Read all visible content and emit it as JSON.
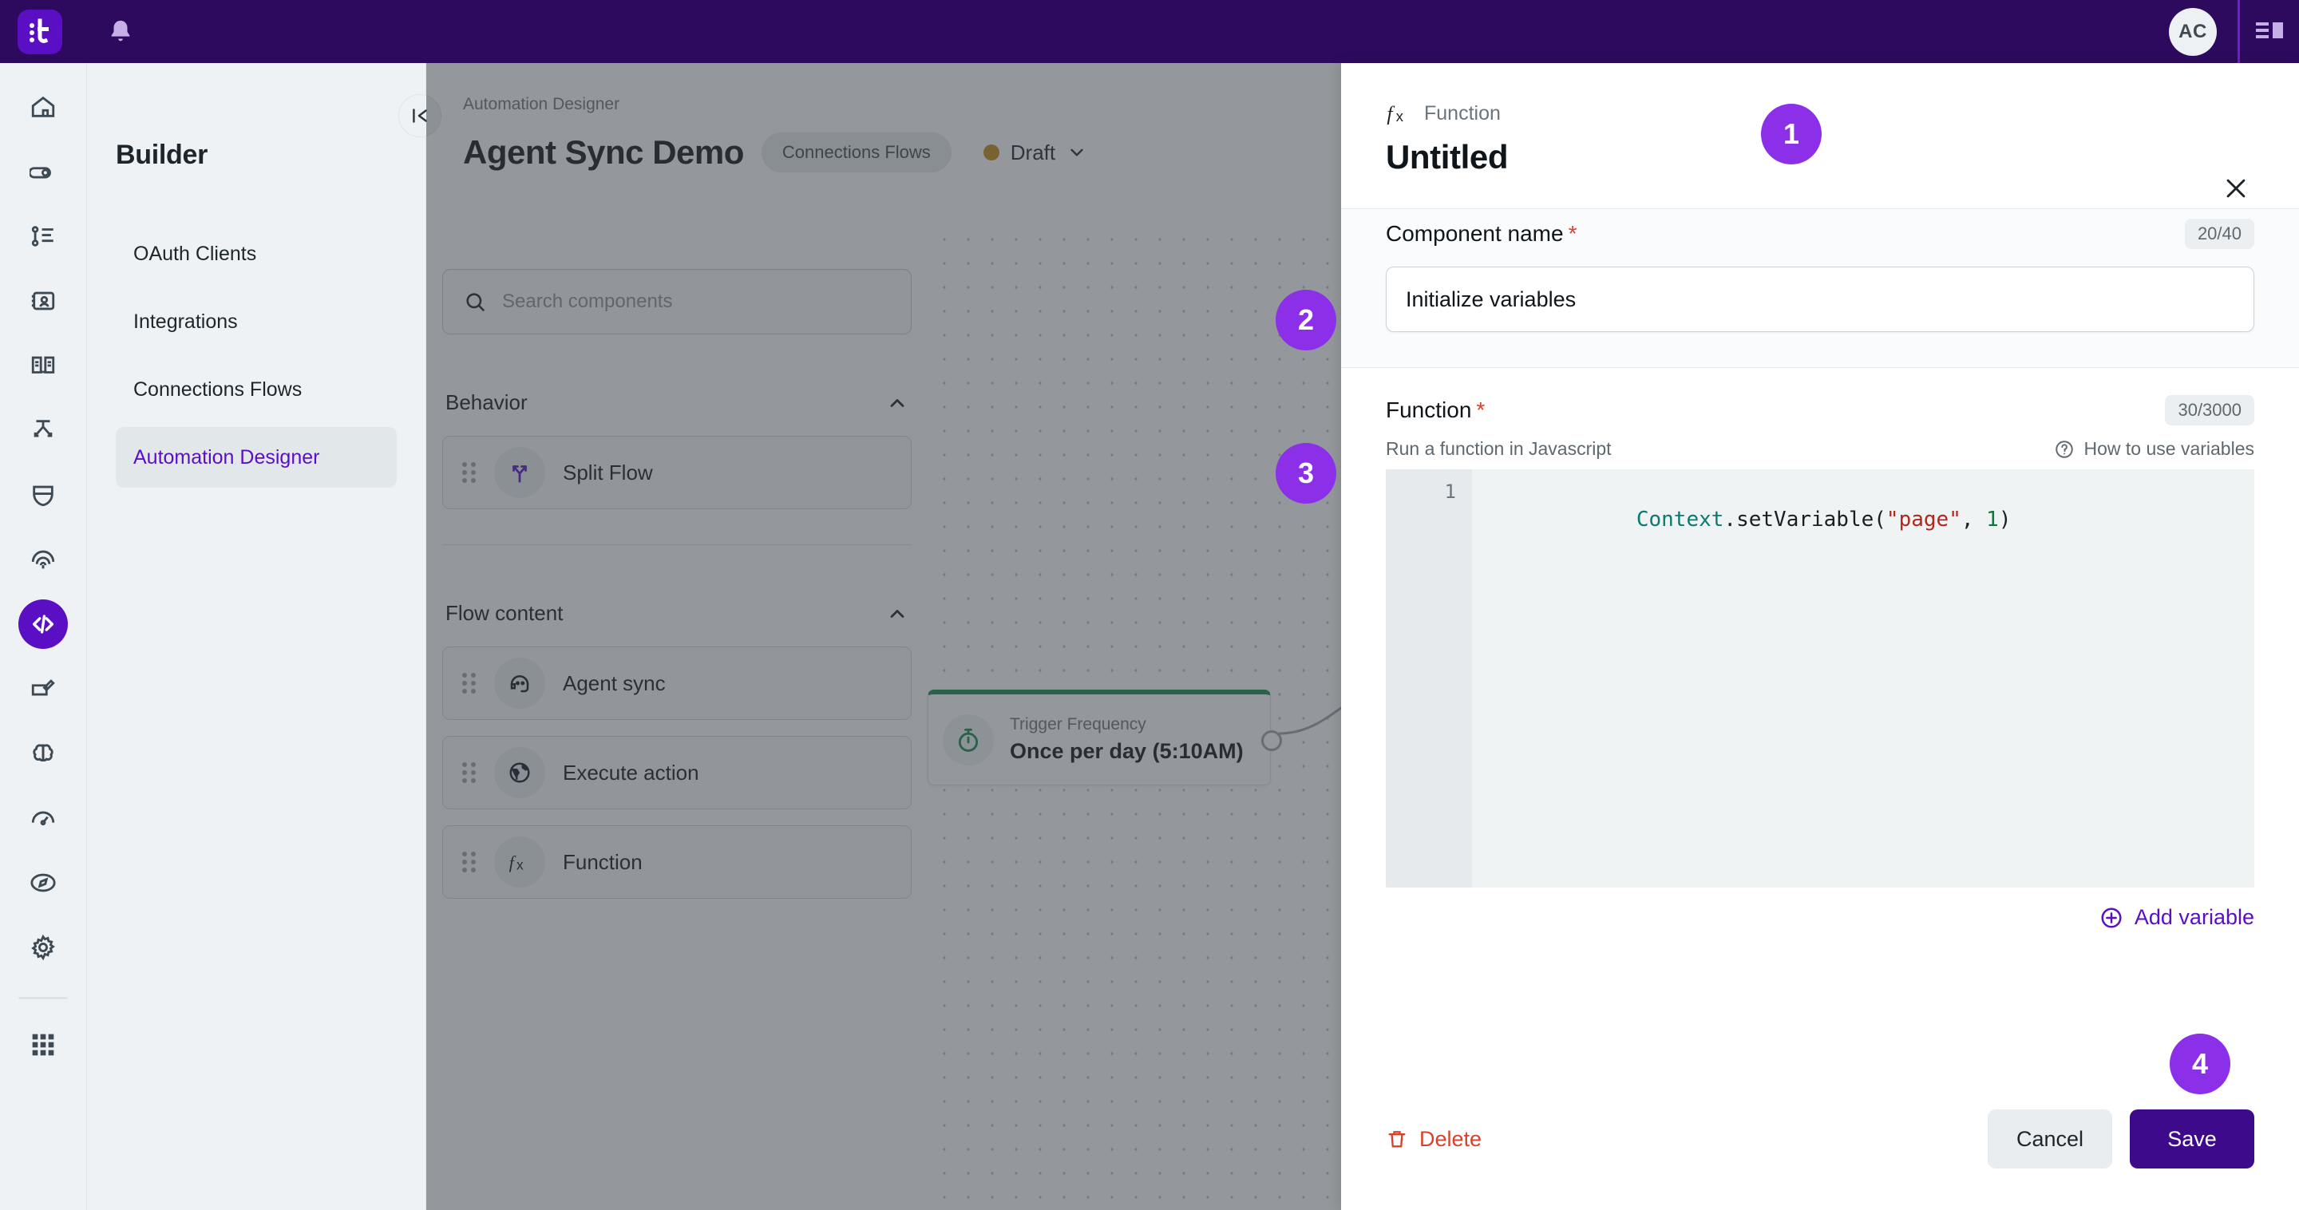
{
  "topbar": {
    "logo_name": "tray-logo",
    "bell_name": "notifications-bell-icon",
    "avatar_initials": "AC",
    "panel_toggle_name": "panel-layout-toggle"
  },
  "rail": {
    "items": [
      {
        "icon": "home-icon",
        "name": "rail-item-home",
        "active": false
      },
      {
        "icon": "link-icon",
        "name": "rail-item-connections",
        "active": false
      },
      {
        "icon": "list-tree-icon",
        "name": "rail-item-hierarchy",
        "active": false
      },
      {
        "icon": "contact-card-icon",
        "name": "rail-item-contacts",
        "active": false
      },
      {
        "icon": "book-icon",
        "name": "rail-item-knowledge",
        "active": false
      },
      {
        "icon": "routing-icon",
        "name": "rail-item-routing",
        "active": false
      },
      {
        "icon": "shield-icon",
        "name": "rail-item-security",
        "active": false
      },
      {
        "icon": "fingerprint-icon",
        "name": "rail-item-identity",
        "active": false
      },
      {
        "icon": "code-icon",
        "name": "rail-item-builder",
        "active": true
      },
      {
        "icon": "edit-box-icon",
        "name": "rail-item-editor",
        "active": false
      },
      {
        "icon": "brain-icon",
        "name": "rail-item-ai",
        "active": false
      },
      {
        "icon": "gauge-icon",
        "name": "rail-item-analytics",
        "active": false
      },
      {
        "icon": "compass-icon",
        "name": "rail-item-explore",
        "active": false
      },
      {
        "icon": "gear-icon",
        "name": "rail-item-settings",
        "active": false
      }
    ],
    "apps_icon": "apps-grid-icon"
  },
  "builder": {
    "title": "Builder",
    "items": [
      {
        "label": "OAuth Clients",
        "active": false
      },
      {
        "label": "Integrations",
        "active": false
      },
      {
        "label": "Connections Flows",
        "active": false
      },
      {
        "label": "Automation Designer",
        "active": true
      }
    ],
    "collapse_icon": "collapse-panel-icon"
  },
  "designer": {
    "breadcrumb": "Automation Designer",
    "flow_title": "Agent Sync Demo",
    "chip": "Connections Flows",
    "status": "Draft",
    "status_color": "#c08a16",
    "status_caret": "chevron-down-icon"
  },
  "palette": {
    "search_placeholder": "Search components",
    "search_icon": "search-icon",
    "sections": [
      {
        "title": "Behavior",
        "collapse_icon": "chevron-up-icon",
        "items": [
          {
            "label": "Split Flow",
            "icon": "split-flow-icon",
            "handle": "drag-handle-icon"
          }
        ]
      },
      {
        "title": "Flow content",
        "collapse_icon": "chevron-up-icon",
        "items": [
          {
            "label": "Agent sync",
            "icon": "headset-agent-icon",
            "handle": "drag-handle-icon"
          },
          {
            "label": "Execute action",
            "icon": "globe-icon",
            "handle": "drag-handle-icon"
          },
          {
            "label": "Function",
            "icon": "fx-icon",
            "handle": "drag-handle-icon"
          }
        ]
      }
    ]
  },
  "canvas": {
    "node": {
      "icon": "stopwatch-icon",
      "sub_label": "Trigger Frequency",
      "main_label": "Once per day (5:10AM)",
      "accent_color": "#0f8a4a",
      "port_name": "node-output-port"
    }
  },
  "side_panel": {
    "kicker_icon": "fx-icon",
    "kicker": "Function",
    "title": "Untitled",
    "close_icon": "close-icon",
    "component_name": {
      "label": "Component name",
      "required_mark": "*",
      "counter": "20/40",
      "value": "Initialize variables"
    },
    "function": {
      "label": "Function",
      "required_mark": "*",
      "counter": "30/3000",
      "hint": "Run a function in Javascript",
      "help_icon": "help-circle-icon",
      "help_label": "How to use variables",
      "line_number": "1",
      "code_tokens": [
        {
          "text": "Context",
          "type": "class"
        },
        {
          "text": ".setVariable(",
          "type": "punct"
        },
        {
          "text": "\"page\"",
          "type": "string"
        },
        {
          "text": ", ",
          "type": "punct"
        },
        {
          "text": "1",
          "type": "number"
        },
        {
          "text": ")",
          "type": "punct"
        }
      ]
    },
    "add_variable": {
      "icon": "plus-circle-icon",
      "label": "Add variable"
    },
    "delete": {
      "icon": "trash-icon",
      "label": "Delete"
    },
    "cancel_label": "Cancel",
    "save_label": "Save"
  },
  "step_badges": [
    {
      "number": "1"
    },
    {
      "number": "2"
    },
    {
      "number": "3"
    },
    {
      "number": "4"
    }
  ],
  "colors": {
    "brand_purple": "#5b0fc4",
    "dark_purple": "#2d0a5e",
    "badge_purple": "#8b2fe8",
    "save_purple": "#3d0a8c",
    "danger_red": "#d8422c",
    "green": "#0f8a4a"
  }
}
